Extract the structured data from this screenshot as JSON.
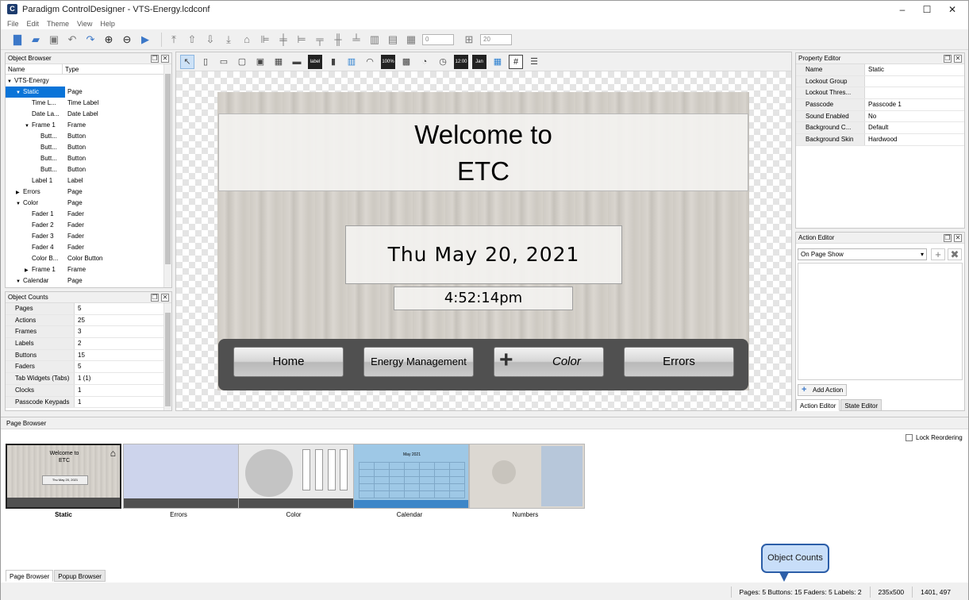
{
  "window": {
    "title": "Paradigm ControlDesigner - VTS-Energy.lcdconf",
    "app_icon": "C"
  },
  "menu": [
    "File",
    "Edit",
    "Theme",
    "View",
    "Help"
  ],
  "toolbar": {
    "icons": [
      "new-file-icon",
      "open-folder-icon",
      "save-icon",
      "undo-icon",
      "redo-icon",
      "zoom-in-icon",
      "zoom-out-icon",
      "run-icon",
      "bring-front-icon",
      "move-up-icon",
      "move-down-icon",
      "send-back-icon",
      "lock-icon",
      "align-left-icon",
      "align-center-icon",
      "align-right-icon",
      "align-top-icon",
      "align-middle-icon",
      "align-bottom-icon",
      "columns-icon",
      "rows-icon",
      "grid-icon",
      "grid-size-icon"
    ],
    "grid_value": "0",
    "grid_size_value": "20"
  },
  "object_browser": {
    "title": "Object Browser",
    "columns": [
      "Name",
      "Type"
    ],
    "rows": [
      {
        "indent": 0,
        "arrow": "▼",
        "name": "VTS-Energy",
        "type": ""
      },
      {
        "indent": 1,
        "arrow": "▼",
        "name": "Static",
        "type": "Page",
        "selected": true
      },
      {
        "indent": 2,
        "arrow": "",
        "name": "Time L...",
        "type": "Time Label"
      },
      {
        "indent": 2,
        "arrow": "",
        "name": "Date La...",
        "type": "Date Label"
      },
      {
        "indent": 2,
        "arrow": "▼",
        "name": "Frame 1",
        "type": "Frame"
      },
      {
        "indent": 3,
        "arrow": "",
        "name": "Butt...",
        "type": "Button"
      },
      {
        "indent": 3,
        "arrow": "",
        "name": "Butt...",
        "type": "Button"
      },
      {
        "indent": 3,
        "arrow": "",
        "name": "Butt...",
        "type": "Button"
      },
      {
        "indent": 3,
        "arrow": "",
        "name": "Butt...",
        "type": "Button"
      },
      {
        "indent": 2,
        "arrow": "",
        "name": "Label 1",
        "type": "Label"
      },
      {
        "indent": 1,
        "arrow": "▶",
        "name": "Errors",
        "type": "Page"
      },
      {
        "indent": 1,
        "arrow": "▼",
        "name": "Color",
        "type": "Page"
      },
      {
        "indent": 2,
        "arrow": "",
        "name": "Fader 1",
        "type": "Fader"
      },
      {
        "indent": 2,
        "arrow": "",
        "name": "Fader 2",
        "type": "Fader"
      },
      {
        "indent": 2,
        "arrow": "",
        "name": "Fader 3",
        "type": "Fader"
      },
      {
        "indent": 2,
        "arrow": "",
        "name": "Fader 4",
        "type": "Fader"
      },
      {
        "indent": 2,
        "arrow": "",
        "name": "Color B...",
        "type": "Color Button"
      },
      {
        "indent": 2,
        "arrow": "▶",
        "name": "Frame 1",
        "type": "Frame"
      },
      {
        "indent": 1,
        "arrow": "▼",
        "name": "Calendar",
        "type": "Page"
      }
    ]
  },
  "object_counts": {
    "title": "Object Counts",
    "rows": [
      {
        "k": "Pages",
        "v": "5"
      },
      {
        "k": "Actions",
        "v": "25"
      },
      {
        "k": "Frames",
        "v": "3"
      },
      {
        "k": "Labels",
        "v": "2"
      },
      {
        "k": "Buttons",
        "v": "15"
      },
      {
        "k": "Faders",
        "v": "5"
      },
      {
        "k": "Tab Widgets (Tabs)",
        "v": "1 (1)"
      },
      {
        "k": "Clocks",
        "v": "1"
      },
      {
        "k": "Passcode Keypads",
        "v": "1"
      }
    ]
  },
  "canvas_tools": [
    "pointer-icon",
    "page-icon",
    "popup-icon",
    "frame-icon",
    "border-frame-icon",
    "table-icon",
    "button-icon",
    "label-icon",
    "fader-icon",
    "level-meter-icon",
    "gauge-icon",
    "percent-icon",
    "color-bar-icon",
    "timer-icon",
    "clock-icon",
    "time-label-icon",
    "date-label-icon",
    "color-picker-icon",
    "keypad-icon",
    "list-icon"
  ],
  "canvas_tool_labels": {
    "label": "label",
    "percent": "100%",
    "time": "12:00",
    "date": "Jan",
    "keypad": "#"
  },
  "page": {
    "welcome_line1": "Welcome to",
    "welcome_line2": "ETC",
    "date": "Thu May 20, 2021",
    "time": "4:52:14pm",
    "nav_buttons": [
      "Home",
      "Energy Management",
      "Color",
      "Errors"
    ],
    "color_button_plus": "+"
  },
  "property_editor": {
    "title": "Property Editor",
    "rows": [
      {
        "k": "Name",
        "v": "Static"
      },
      {
        "k": "Lockout Group",
        "v": ""
      },
      {
        "k": "Lockout Thres...",
        "v": ""
      },
      {
        "k": "Passcode",
        "v": "Passcode 1"
      },
      {
        "k": "Sound Enabled",
        "v": "No"
      },
      {
        "k": "Background C...",
        "v": "Default"
      },
      {
        "k": "Background Skin",
        "v": "Hardwood"
      }
    ]
  },
  "action_editor": {
    "title": "Action Editor",
    "trigger": "On Page Show",
    "add_action": "Add Action",
    "tabs": [
      "Action Editor",
      "State Editor"
    ]
  },
  "page_browser": {
    "title": "Page Browser",
    "lock_reordering": "Lock Reordering",
    "pages": [
      "Static",
      "Errors",
      "Color",
      "Calendar",
      "Numbers"
    ],
    "thumb_static": {
      "l1": "Welcome to",
      "l2": "ETC",
      "date": "Thu May 20, 2021"
    },
    "thumb_calendar_title": "May 2021",
    "tabs": [
      "Page Browser",
      "Popup Browser"
    ]
  },
  "callout": "Object Counts",
  "status": {
    "counts": "Pages: 5  Buttons: 15  Faders: 5  Labels: 2",
    "size": "235x500",
    "coords": "1401, 497"
  },
  "colors": {
    "selection": "#0a74d8",
    "accent": "#3c78c8",
    "nav_frame": "#505050",
    "callout_bg": "#c8def9",
    "callout_border": "#2c5ea8"
  }
}
